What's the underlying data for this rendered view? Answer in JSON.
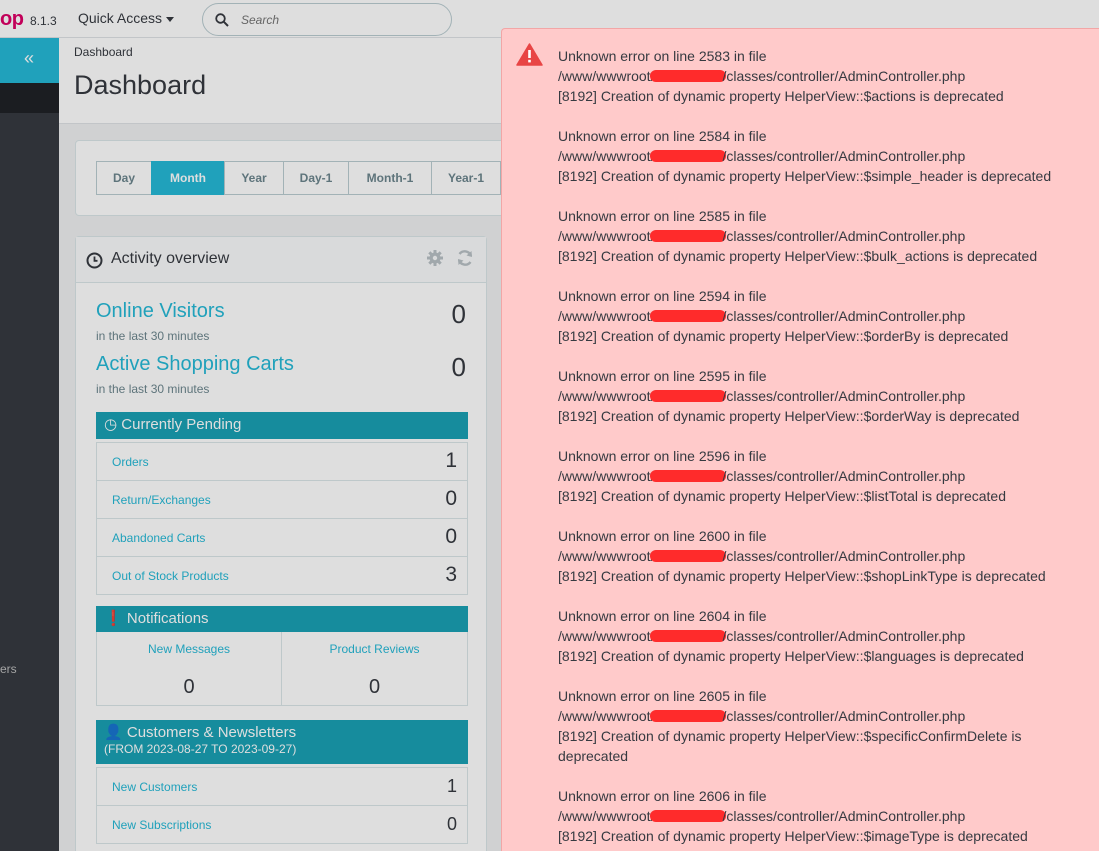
{
  "topbar": {
    "logo": "op",
    "version": "8.1.3",
    "quick_access": "Quick Access",
    "search_placeholder": "Search"
  },
  "sidebar": {
    "collapse_icon": "«",
    "partial_label": "ers"
  },
  "header": {
    "breadcrumb": "Dashboard",
    "title": "Dashboard"
  },
  "period": {
    "buttons": [
      {
        "label": "Day",
        "active": false
      },
      {
        "label": "Month",
        "active": true
      },
      {
        "label": "Year",
        "active": false
      },
      {
        "label": "Day-1",
        "active": false
      },
      {
        "label": "Month-1",
        "active": false
      },
      {
        "label": "Year-1",
        "active": false
      }
    ]
  },
  "activity": {
    "title": "Activity overview",
    "online_visitors": {
      "label": "Online Visitors",
      "sub": "in the last 30 minutes",
      "value": "0"
    },
    "active_carts": {
      "label": "Active Shopping Carts",
      "sub": "in the last 30 minutes",
      "value": "0"
    },
    "pending": {
      "title": "Currently Pending",
      "rows": [
        {
          "label": "Orders",
          "value": "1"
        },
        {
          "label": "Return/Exchanges",
          "value": "0"
        },
        {
          "label": "Abandoned Carts",
          "value": "0"
        },
        {
          "label": "Out of Stock Products",
          "value": "3"
        }
      ]
    },
    "notifications": {
      "title": "Notifications",
      "new_messages": {
        "label": "New Messages",
        "value": "0"
      },
      "product_reviews": {
        "label": "Product Reviews",
        "value": "0"
      }
    },
    "customers": {
      "title": "Customers & Newsletters",
      "range": "(FROM 2023-08-27 TO 2023-09-27)",
      "rows": [
        {
          "label": "New Customers",
          "value": "1"
        },
        {
          "label": "New Subscriptions",
          "value": "0"
        }
      ]
    }
  },
  "errors": {
    "colors": {
      "background": "#ffcaca",
      "icon": "#e84545",
      "redaction": "#ff2b2b"
    },
    "entries": [
      {
        "line": "Unknown error on line 2583 in file",
        "file_prefix": "/www/wwwroot/",
        "file_suffix": "/classes/controller/AdminController.php",
        "message": "[8192] Creation of dynamic property HelperView::$actions is deprecated"
      },
      {
        "line": "Unknown error on line 2584 in file",
        "file_prefix": "/www/wwwroot/",
        "file_suffix": "/classes/controller/AdminController.php",
        "message": "[8192] Creation of dynamic property HelperView::$simple_header is deprecated"
      },
      {
        "line": "Unknown error on line 2585 in file",
        "file_prefix": "/www/wwwroot/",
        "file_suffix": "/classes/controller/AdminController.php",
        "message": "[8192] Creation of dynamic property HelperView::$bulk_actions is deprecated"
      },
      {
        "line": "Unknown error on line 2594 in file",
        "file_prefix": "/www/wwwroot/",
        "file_suffix": "/classes/controller/AdminController.php",
        "message": "[8192] Creation of dynamic property HelperView::$orderBy is deprecated"
      },
      {
        "line": "Unknown error on line 2595 in file",
        "file_prefix": "/www/wwwroot/",
        "file_suffix": "/classes/controller/AdminController.php",
        "message": "[8192] Creation of dynamic property HelperView::$orderWay is deprecated"
      },
      {
        "line": "Unknown error on line 2596 in file",
        "file_prefix": "/www/wwwroot/",
        "file_suffix": "/classes/controller/AdminController.php",
        "message": "[8192] Creation of dynamic property HelperView::$listTotal is deprecated"
      },
      {
        "line": "Unknown error on line 2600 in file",
        "file_prefix": "/www/wwwroot/",
        "file_suffix": "/classes/controller/AdminController.php",
        "message": "[8192] Creation of dynamic property HelperView::$shopLinkType is deprecated"
      },
      {
        "line": "Unknown error on line 2604 in file",
        "file_prefix": "/www/wwwroot/",
        "file_suffix": "/classes/controller/AdminController.php",
        "message": "[8192] Creation of dynamic property HelperView::$languages is deprecated"
      },
      {
        "line": "Unknown error on line 2605 in file",
        "file_prefix": "/www/wwwroot/",
        "file_suffix": "/classes/controller/AdminController.php",
        "message": "[8192] Creation of dynamic property HelperView::$specificConfirmDelete is deprecated"
      },
      {
        "line": "Unknown error on line 2606 in file",
        "file_prefix": "/www/wwwroot/",
        "file_suffix": "/classes/controller/AdminController.php",
        "message": "[8192] Creation of dynamic property HelperView::$imageType is deprecated"
      }
    ]
  }
}
